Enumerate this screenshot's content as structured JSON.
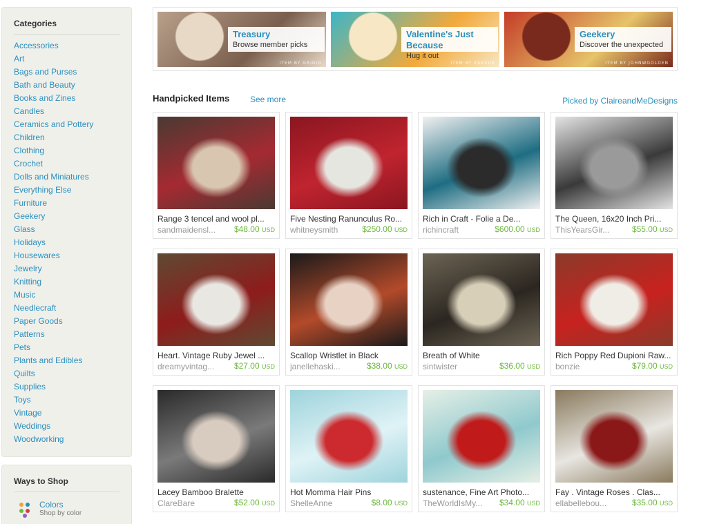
{
  "sidebar": {
    "categories_title": "Categories",
    "categories": [
      "Accessories",
      "Art",
      "Bags and Purses",
      "Bath and Beauty",
      "Books and Zines",
      "Candles",
      "Ceramics and Pottery",
      "Children",
      "Clothing",
      "Crochet",
      "Dolls and Miniatures",
      "Everything Else",
      "Furniture",
      "Geekery",
      "Glass",
      "Holidays",
      "Housewares",
      "Jewelry",
      "Knitting",
      "Music",
      "Needlecraft",
      "Paper Goods",
      "Patterns",
      "Pets",
      "Plants and Edibles",
      "Quilts",
      "Supplies",
      "Toys",
      "Vintage",
      "Weddings",
      "Woodworking"
    ],
    "ways_title": "Ways to Shop",
    "ways": [
      {
        "title": "Colors",
        "subtitle": "Shop by color",
        "icon": "color-dots-icon"
      }
    ]
  },
  "banners": [
    {
      "title": "Treasury",
      "subtitle": "Browse member picks",
      "credit": "ITEM BY GRIGIO",
      "colors": [
        "#b9a08a",
        "#7a5f4e",
        "#e8d9c6"
      ]
    },
    {
      "title": "Valentine's Just Because",
      "subtitle": "Hug it out",
      "credit": "ITEM BY ZUKZUK",
      "colors": [
        "#3bb6c8",
        "#f2a93b",
        "#f7e7c4"
      ]
    },
    {
      "title": "Geekery",
      "subtitle": "Discover the unexpected",
      "credit": "ITEM BY JOHNWGOLDEN",
      "colors": [
        "#c43c28",
        "#e6c46a",
        "#7a2a1c"
      ]
    }
  ],
  "handpicked": {
    "title": "Handpicked Items",
    "see_more": "See more",
    "picked_by": "Picked by ClaireandMeDesigns"
  },
  "currency": "USD",
  "items": [
    {
      "name": "Range 3 tencel and wool pl...",
      "shop": "sandmaidensl...",
      "price": "$48.00",
      "colors": [
        "#a52a32",
        "#d9c6b0",
        "#4a3a32"
      ]
    },
    {
      "name": "Five Nesting Ranunculus Ro...",
      "shop": "whitneysmith",
      "price": "$250.00",
      "colors": [
        "#c0242f",
        "#e6e6e0",
        "#8a1620"
      ]
    },
    {
      "name": "Rich in Craft - Folie a De...",
      "shop": "richincraft",
      "price": "$600.00",
      "colors": [
        "#1e6d82",
        "#2b2b2b",
        "#f0f0f0"
      ]
    },
    {
      "name": "The Queen, 16x20 Inch Pri...",
      "shop": "ThisYearsGir...",
      "price": "$55.00",
      "colors": [
        "#3a3a3a",
        "#9a9a9a",
        "#e4e4e4"
      ]
    },
    {
      "name": "Heart. Vintage Ruby Jewel ...",
      "shop": "dreamyvintag...",
      "price": "$27.00",
      "colors": [
        "#8e1c1c",
        "#e9e7e2",
        "#5e4a32"
      ]
    },
    {
      "name": "Scallop Wristlet in Black",
      "shop": "janellehaski...",
      "price": "$38.00",
      "colors": [
        "#b34a2a",
        "#e8d2c4",
        "#1a1a1a"
      ]
    },
    {
      "name": "Breath of White",
      "shop": "sintwister",
      "price": "$36.00",
      "colors": [
        "#2b2620",
        "#d8cfb8",
        "#6c6454"
      ]
    },
    {
      "name": "Rich Poppy Red Dupioni Raw...",
      "shop": "bonzie",
      "price": "$79.00",
      "colors": [
        "#c8221f",
        "#f0ede6",
        "#8a3a2a"
      ]
    },
    {
      "name": "Lacey Bamboo Bralette",
      "shop": "ClareBare",
      "price": "$52.00",
      "colors": [
        "#7a7a7a",
        "#d8cbbf",
        "#2a2a2a"
      ]
    },
    {
      "name": "Hot Momma Hair Pins",
      "shop": "ShelleAnne",
      "price": "$8.00",
      "colors": [
        "#dff3f6",
        "#cc2a2e",
        "#9fd3dc"
      ]
    },
    {
      "name": "sustenance, Fine Art Photo...",
      "shop": "TheWorldIsMy...",
      "price": "$34.00",
      "colors": [
        "#8fc9cd",
        "#c01a1a",
        "#e6efe6"
      ]
    },
    {
      "name": "Fay . Vintage Roses . Clas...",
      "shop": "ellabellebou...",
      "price": "$35.00",
      "colors": [
        "#e8e6e1",
        "#8a1818",
        "#8a7a5e"
      ]
    }
  ]
}
